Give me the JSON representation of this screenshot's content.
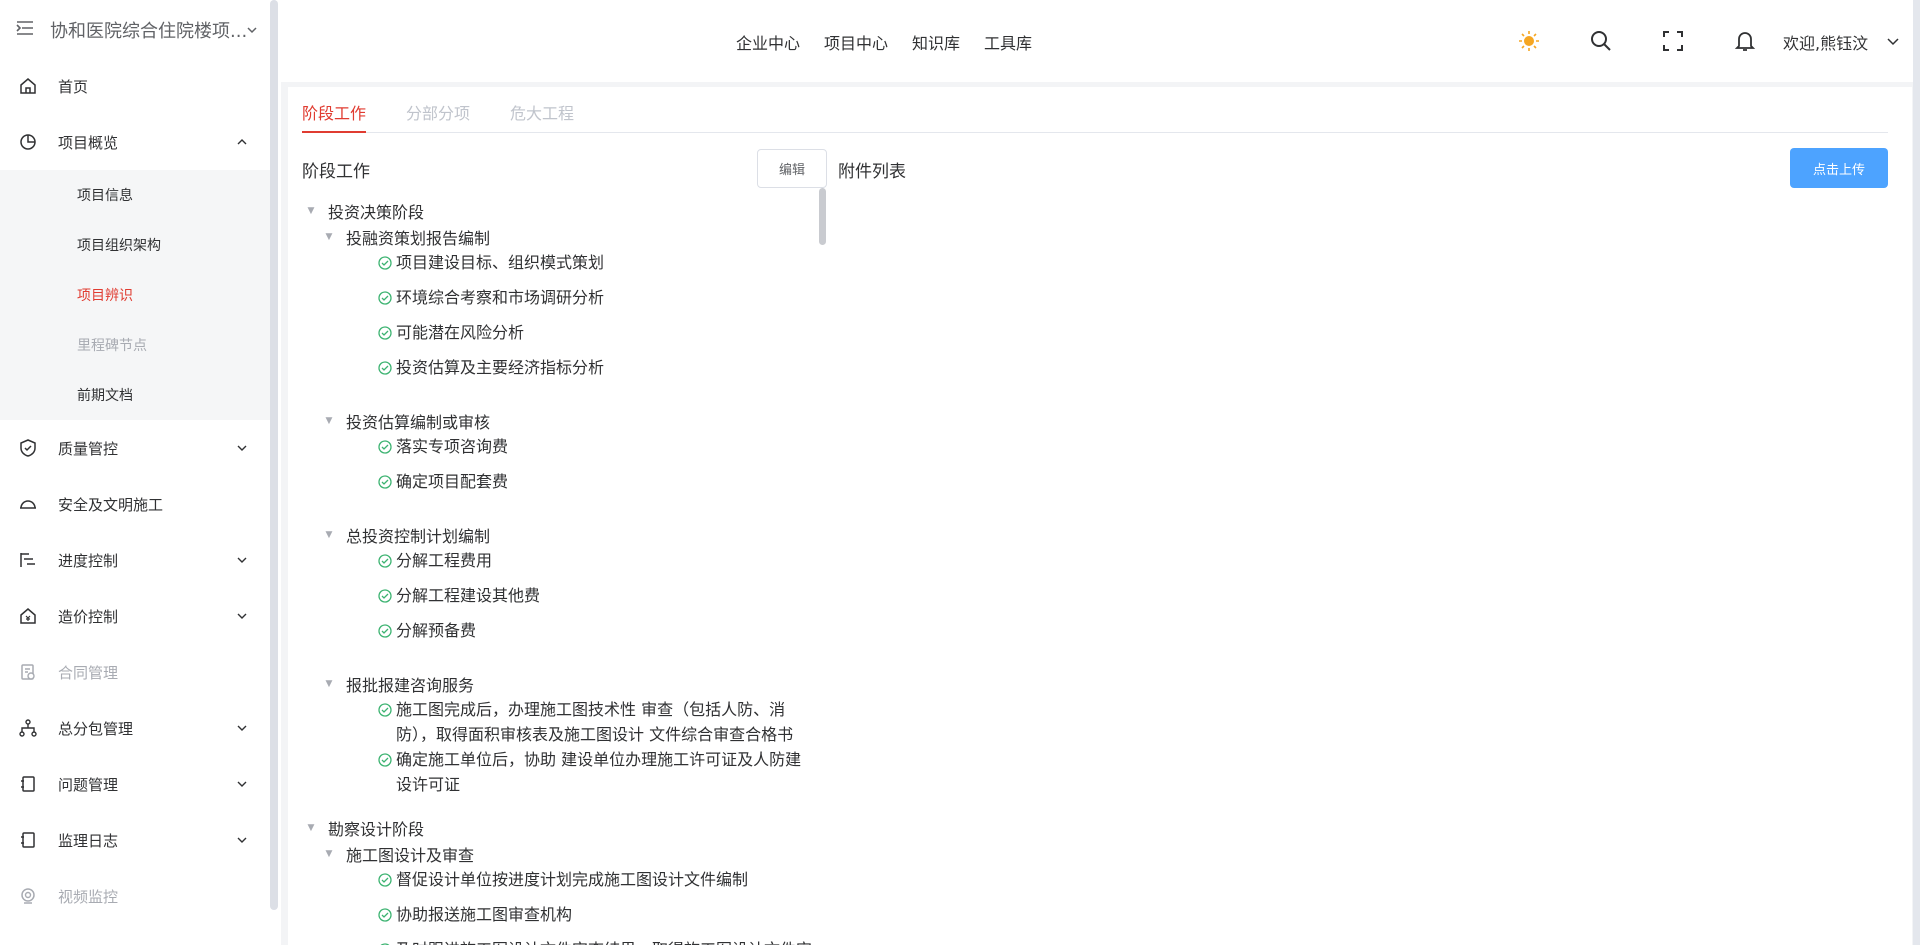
{
  "sidebar": {
    "project_name": "协和医院综合住院楼项...",
    "menu": [
      {
        "label": "首页"
      },
      {
        "label": "项目概览",
        "children": [
          {
            "label": "项目信息"
          },
          {
            "label": "项目组织架构"
          },
          {
            "label": "项目辨识"
          },
          {
            "label": "里程碑节点"
          },
          {
            "label": "前期文档"
          }
        ]
      },
      {
        "label": "质量管控"
      },
      {
        "label": "安全及文明施工"
      },
      {
        "label": "进度控制"
      },
      {
        "label": "造价控制"
      },
      {
        "label": "合同管理"
      },
      {
        "label": "总分包管理"
      },
      {
        "label": "问题管理"
      },
      {
        "label": "监理日志"
      },
      {
        "label": "视频监控"
      }
    ]
  },
  "header": {
    "nav": [
      "企业中心",
      "项目中心",
      "知识库",
      "工具库"
    ],
    "welcome": "欢迎,熊钰汶"
  },
  "tabs": [
    "阶段工作",
    "分部分项",
    "危大工程"
  ],
  "left_panel": {
    "title": "阶段工作",
    "edit_label": "编辑"
  },
  "right_panel": {
    "title": "附件列表",
    "upload_label": "点击上传"
  },
  "tree": [
    {
      "title": "投资决策阶段",
      "groups": [
        {
          "title": "投融资策划报告编制",
          "items": [
            "项目建设目标、组织模式策划",
            "环境综合考察和市场调研分析",
            "可能潜在风险分析",
            "投资估算及主要经济指标分析"
          ]
        },
        {
          "title": "投资估算编制或审核",
          "items": [
            "落实专项咨询费",
            "确定项目配套费"
          ]
        },
        {
          "title": "总投资控制计划编制",
          "items": [
            "分解工程费用",
            "分解工程建设其他费",
            "分解预备费"
          ]
        },
        {
          "title": "报批报建咨询服务",
          "items": [
            "施工图完成后，办理施工图技术性 审查（包括人防、消防），取得面积审核表及施工图设计 文件综合审查合格书",
            "确定施工单位后，协助 建设单位办理施工许可证及人防建设许可证"
          ]
        }
      ]
    },
    {
      "title": "勘察设计阶段",
      "groups": [
        {
          "title": "施工图设计及审查",
          "items": [
            "督促设计单位按进度计划完成施工图设计文件编制",
            "协助报送施工图审查机构",
            "及时跟进施工图设计文件审查结果，取得施工图设计文件审查"
          ]
        }
      ]
    }
  ],
  "colors": {
    "accent": "#e03c31",
    "primary": "#4da3ff",
    "success": "#3cb371",
    "sun": "#f5a623"
  }
}
